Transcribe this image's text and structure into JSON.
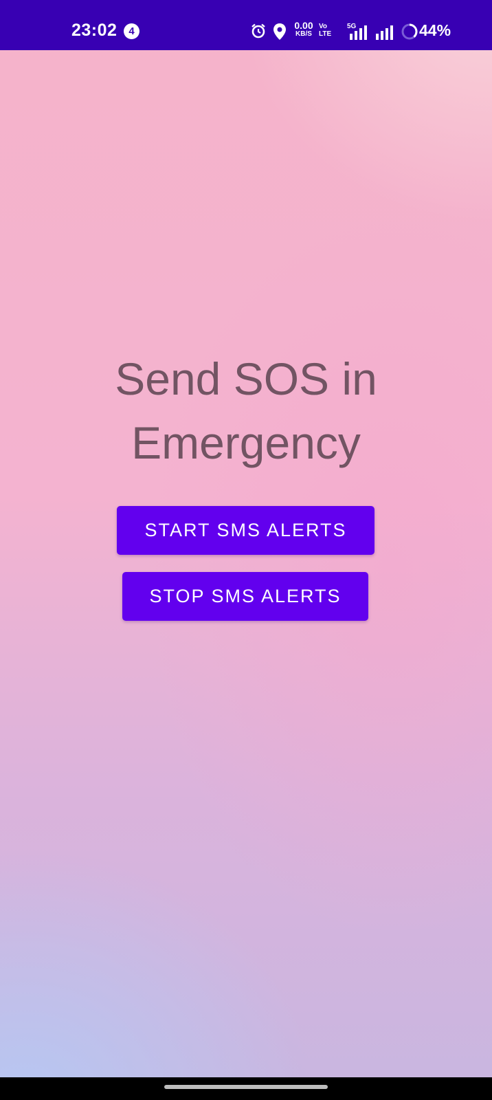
{
  "status_bar": {
    "time": "23:02",
    "notification_count": "4",
    "net_speed_value": "0.00",
    "net_speed_unit": "KB/S",
    "volte_label": "Vo LTE",
    "network_type": "5G",
    "battery_percent": "44%",
    "icons": [
      "alarm-icon",
      "location-icon",
      "signal-icon",
      "signal-icon-2",
      "battery-ring-icon"
    ],
    "background_color": "#3800b3"
  },
  "main": {
    "headline_line1": "Send SOS in",
    "headline_line2": "Emergency",
    "start_button_label": "START SMS ALERTS",
    "stop_button_label": "STOP SMS ALERTS",
    "button_color": "#6200ee",
    "headline_color": "#725463"
  },
  "nav_bar": {
    "home_indicator": "home-pill"
  }
}
